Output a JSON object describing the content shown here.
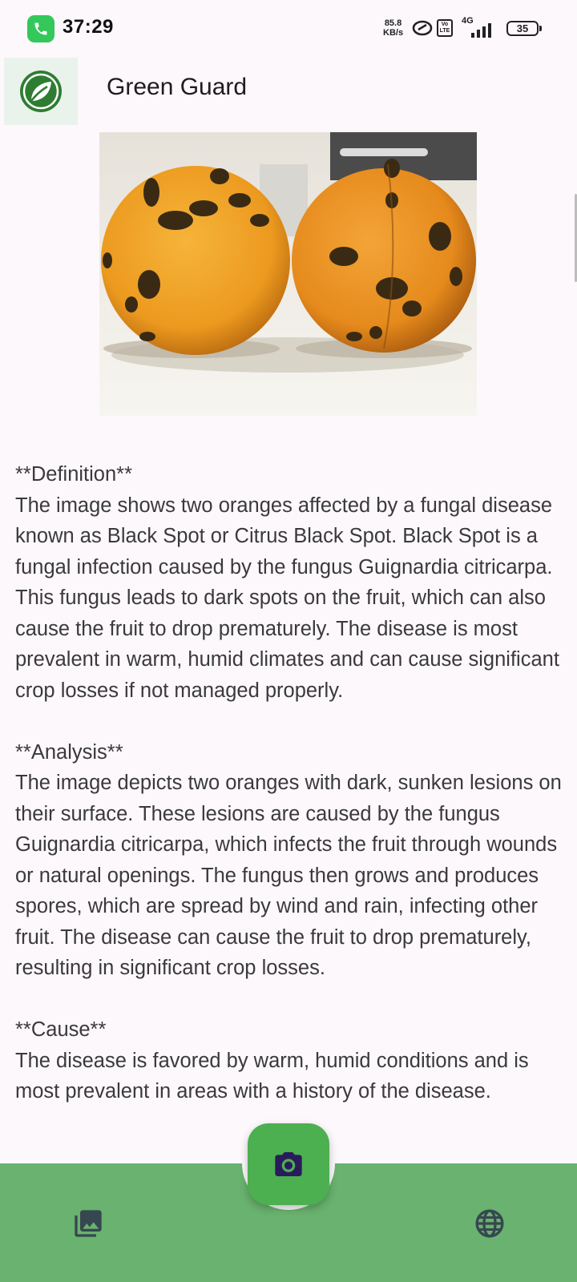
{
  "status_bar": {
    "time": "37:29",
    "net_speed_value": "85.8",
    "net_speed_unit": "KB/s",
    "volte_label": "Vo LTE",
    "network_label": "4G",
    "battery_level": "35"
  },
  "header": {
    "title": "Green Guard",
    "logo_icon": "leaf-logo-icon"
  },
  "image": {
    "subject": "two-oranges-black-spot-photo"
  },
  "content": {
    "definition_heading": " **Definition**",
    "definition_text": "The image shows two oranges affected by a fungal disease known as Black Spot or Citrus Black Spot. Black Spot is a fungal infection caused by the fungus Guignardia citricarpa. This fungus leads to dark spots on the fruit, which can also cause the fruit to drop prematurely. The disease is most prevalent in warm, humid climates and can cause significant crop losses if not managed properly.",
    "analysis_heading": "**Analysis**",
    "analysis_text": "The image depicts two oranges with dark, sunken lesions on their surface. These lesions are caused by the fungus Guignardia citricarpa, which infects the fruit through wounds or natural openings. The fungus then grows and produces spores, which are spread by wind and rain, infecting other fruit. The disease can cause the fruit to drop prematurely, resulting in significant crop losses.",
    "cause_heading": "**Cause**",
    "cause_text": "The disease is favored by warm, humid conditions and is most prevalent in areas with a history of the disease."
  },
  "bottom_nav": {
    "gallery_icon": "gallery-icon",
    "camera_icon": "camera-icon",
    "language_icon": "globe-icon"
  },
  "colors": {
    "accent_green": "#4caf50",
    "bar_green": "#69b26f",
    "logo_green": "#2e7d32",
    "background": "#fdf8fc"
  }
}
